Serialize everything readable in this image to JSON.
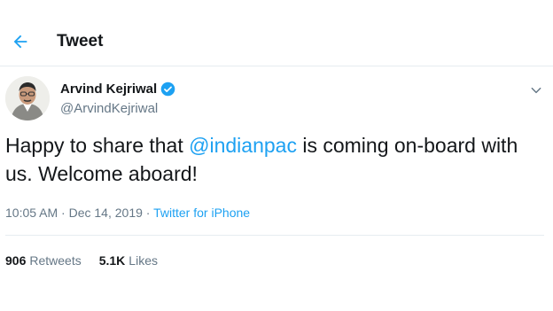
{
  "header": {
    "title": "Tweet",
    "back_icon": "arrow-left-icon"
  },
  "author": {
    "name": "Arvind Kejriwal",
    "handle": "@ArvindKejriwal",
    "verified_icon": "verified-badge-icon"
  },
  "tweet": {
    "text_before": "Happy to share that ",
    "mention": "@indianpac",
    "text_after": " is coming on-board with us. Welcome aboard!",
    "time": "10:05 AM",
    "date": "Dec 14, 2019",
    "source": "Twitter for iPhone",
    "separator": " · "
  },
  "stats": {
    "retweets_count": "906",
    "retweets_label": "Retweets",
    "likes_count": "5.1K",
    "likes_label": "Likes"
  },
  "colors": {
    "accent": "#1da1f2",
    "text": "#14171a",
    "secondary": "#657786",
    "divider": "#e6ecf0"
  }
}
